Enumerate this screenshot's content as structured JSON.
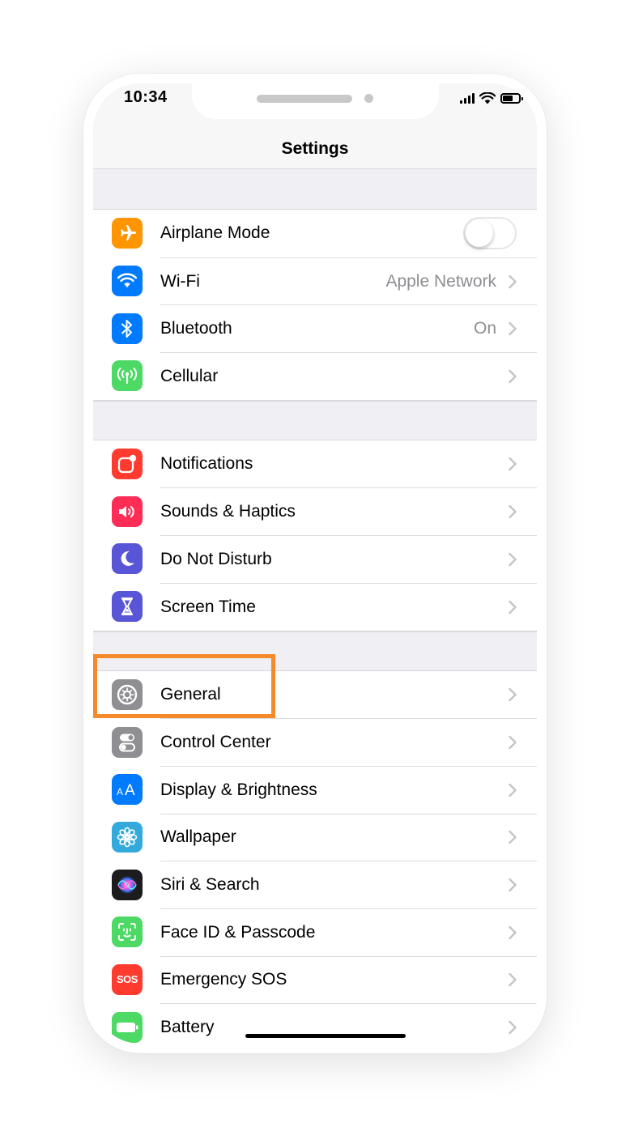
{
  "status_bar": {
    "time": "10:34"
  },
  "nav": {
    "title": "Settings"
  },
  "groups": [
    {
      "items": [
        {
          "label": "Airplane Mode",
          "icon": "airplane-icon",
          "color": "#ff9500",
          "control": "toggle",
          "toggle_on": false
        },
        {
          "label": "Wi-Fi",
          "icon": "wifi-icon",
          "color": "#007aff",
          "value": "Apple Network"
        },
        {
          "label": "Bluetooth",
          "icon": "bluetooth-icon",
          "color": "#007aff",
          "value": "On"
        },
        {
          "label": "Cellular",
          "icon": "cellular-icon",
          "color": "#4cd964"
        }
      ]
    },
    {
      "items": [
        {
          "label": "Notifications",
          "icon": "notifications-icon",
          "color": "#ff3b30"
        },
        {
          "label": "Sounds & Haptics",
          "icon": "speaker-icon",
          "color": "#ff2d55"
        },
        {
          "label": "Do Not Disturb",
          "icon": "moon-icon",
          "color": "#5856d6"
        },
        {
          "label": "Screen Time",
          "icon": "hourglass-icon",
          "color": "#5856d6"
        }
      ]
    },
    {
      "items": [
        {
          "label": "General",
          "icon": "gear-icon",
          "color": "#8e8e93",
          "highlighted": true
        },
        {
          "label": "Control Center",
          "icon": "switches-icon",
          "color": "#8e8e93"
        },
        {
          "label": "Display & Brightness",
          "icon": "text-size-icon",
          "color": "#007aff"
        },
        {
          "label": "Wallpaper",
          "icon": "flower-icon",
          "color": "#34aadc"
        },
        {
          "label": "Siri & Search",
          "icon": "siri-icon",
          "color": "#1c1c1e"
        },
        {
          "label": "Face ID & Passcode",
          "icon": "face-id-icon",
          "color": "#4cd964"
        },
        {
          "label": "Emergency SOS",
          "icon": "sos-icon",
          "color": "#ff3b30",
          "icon_text": "SOS"
        },
        {
          "label": "Battery",
          "icon": "battery-icon",
          "color": "#4cd964"
        }
      ]
    }
  ],
  "highlight_color": "#f58a2a"
}
